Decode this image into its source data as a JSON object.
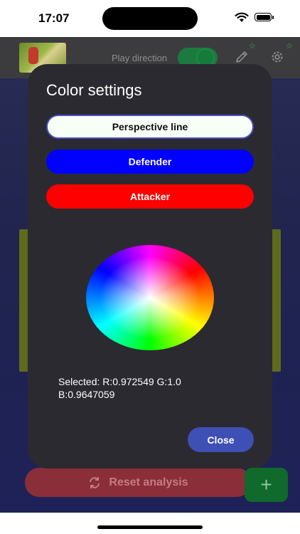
{
  "status_bar": {
    "time": "17:07"
  },
  "toolbar": {
    "play_direction_label": "Play direction"
  },
  "dialog": {
    "title": "Color settings",
    "options": [
      {
        "label": "Perspective line",
        "color": "#f7fff6",
        "selected": true
      },
      {
        "label": "Defender",
        "color": "#0000ff"
      },
      {
        "label": "Attacker",
        "color": "#ff0000"
      }
    ],
    "selected_text": "Selected: R:0.972549 G:1.0 B:0.9647059",
    "close_label": "Close"
  },
  "background": {
    "reset_label": "Reset analysis",
    "fab_label": "+"
  },
  "colors": {
    "dialog_bg": "#2b2a30",
    "accent": "#3e4fb5",
    "reset": "#8a2e3a",
    "fab": "#0f6a2b"
  },
  "icons": [
    "wifi-icon",
    "battery-icon",
    "pencil-icon",
    "gear-icon",
    "star-icon",
    "refresh-icon",
    "plus-icon"
  ]
}
